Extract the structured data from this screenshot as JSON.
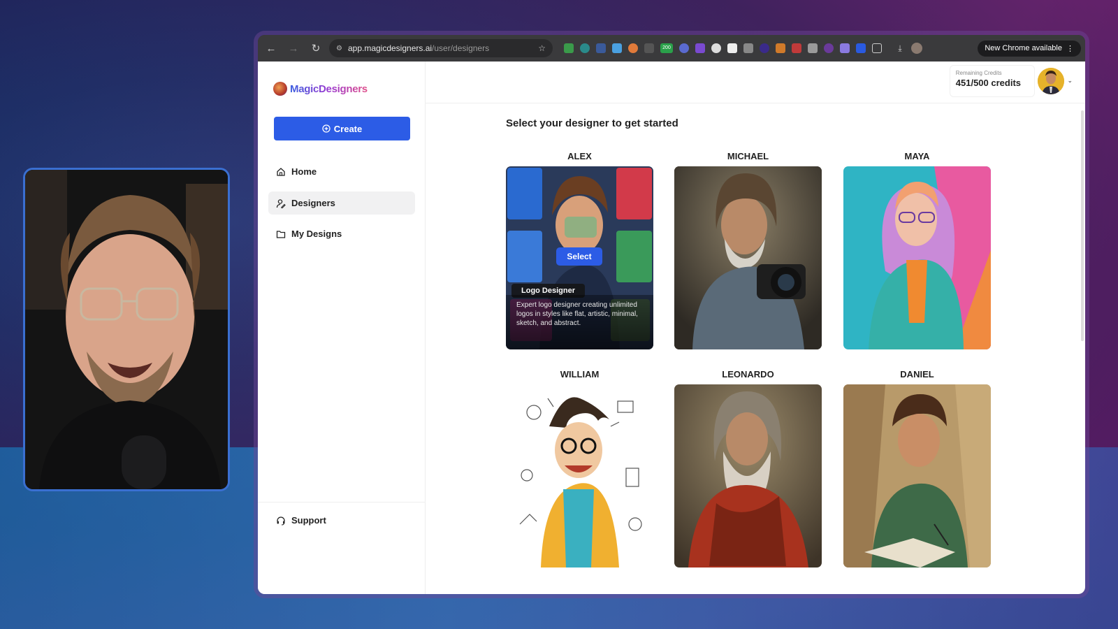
{
  "browser": {
    "url_domain": "app.magicdesigners.ai",
    "url_path": "/user/designers",
    "new_chrome_label": "New Chrome available",
    "extension_badge": "200"
  },
  "sidebar": {
    "logo_text": "MagicDesigners",
    "create_label": "Create",
    "items": [
      {
        "label": "Home",
        "icon": "home-icon"
      },
      {
        "label": "Designers",
        "icon": "designers-icon",
        "active": true
      },
      {
        "label": "My Designs",
        "icon": "folder-icon"
      }
    ],
    "support_label": "Support"
  },
  "header": {
    "credits_label": "Remaining Credits",
    "credits_value": "451/500 credits"
  },
  "main": {
    "title": "Select your designer to get started",
    "designers": [
      {
        "name": "ALEX",
        "hovered": true,
        "select_label": "Select",
        "role": "Logo Designer",
        "description": "Expert logo designer creating unlimited logos in styles like flat, artistic, minimal, sketch, and abstract.",
        "colors": [
          "#2a6ad0",
          "#d23a4a",
          "#3a9a5a",
          "#e0b060"
        ]
      },
      {
        "name": "MICHAEL",
        "colors": [
          "#4a4438",
          "#8a7a62",
          "#2b2b2b"
        ]
      },
      {
        "name": "MAYA",
        "colors": [
          "#2fb4c4",
          "#e85aa0",
          "#f08a40",
          "#35b0a8"
        ]
      },
      {
        "name": "WILLIAM",
        "colors": [
          "#ffffff",
          "#f0c030",
          "#2a2a2a"
        ]
      },
      {
        "name": "LEONARDO",
        "colors": [
          "#6a5a48",
          "#a8321e",
          "#d8d0c4"
        ]
      },
      {
        "name": "DANIEL",
        "colors": [
          "#b89a6a",
          "#3e6a48",
          "#5a3a28"
        ]
      }
    ]
  }
}
